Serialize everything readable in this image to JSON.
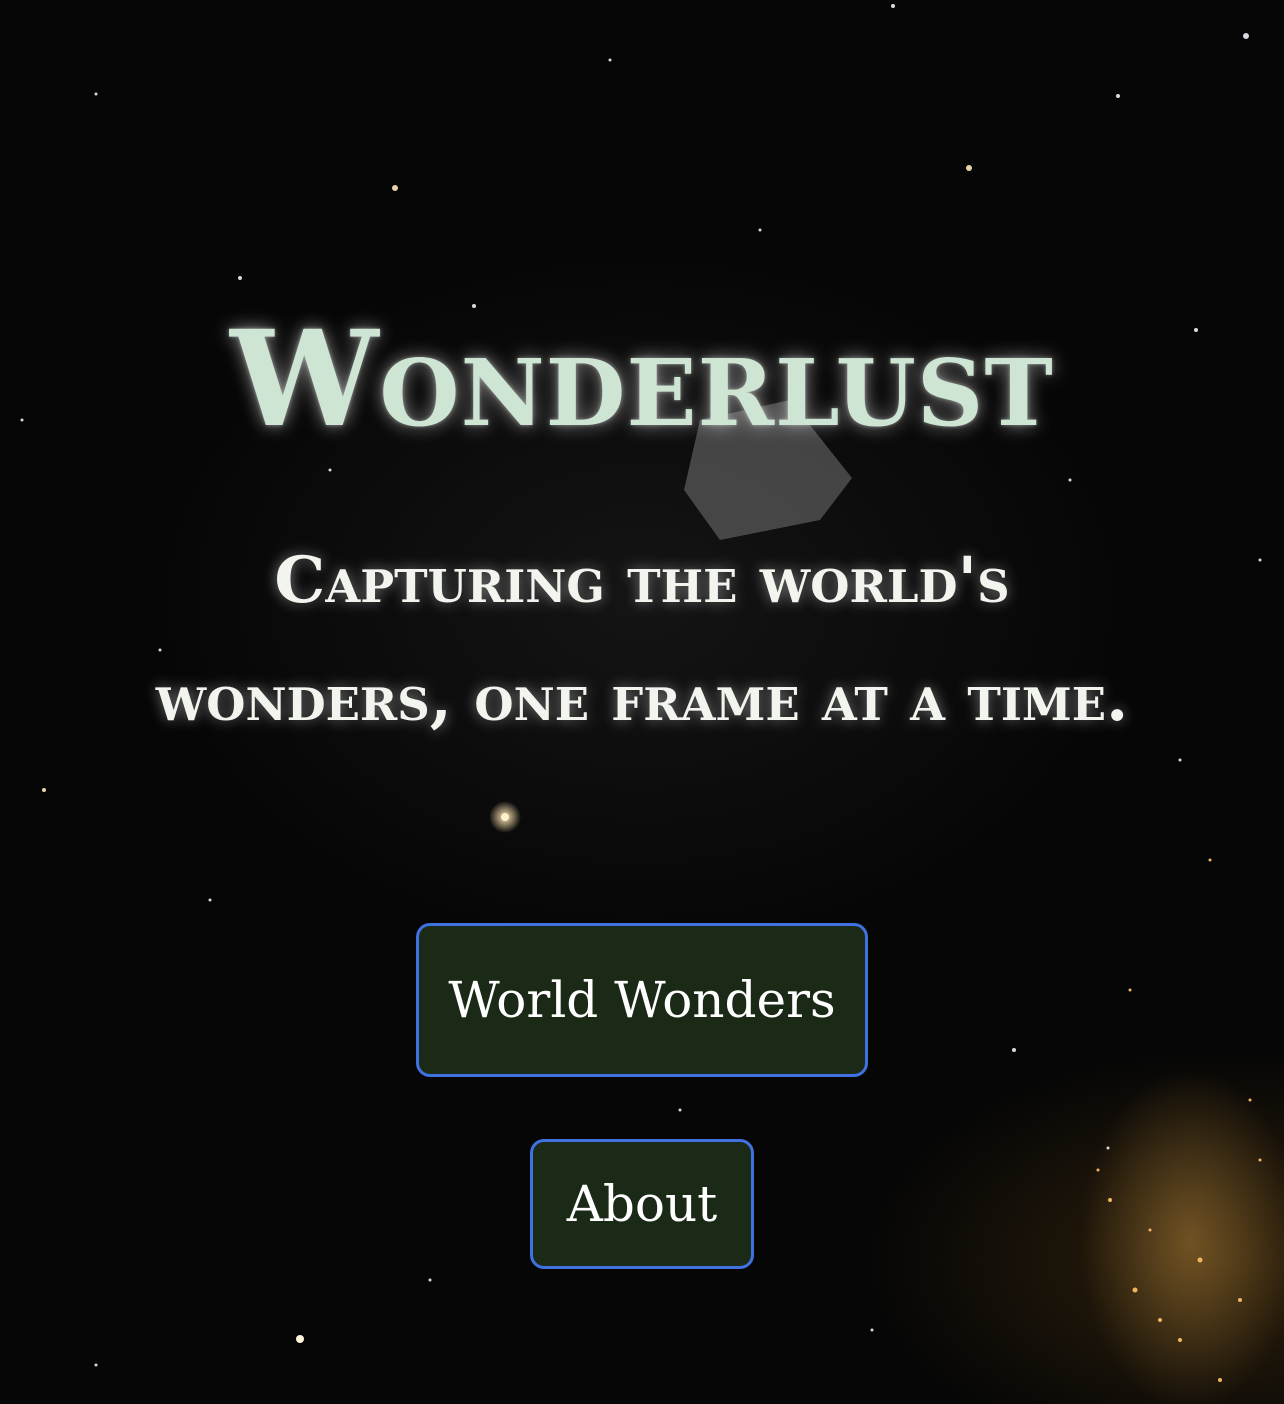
{
  "hero": {
    "title": "Wonderlust",
    "tagline": "Capturing the world's wonders, one frame at a time."
  },
  "nav": {
    "world_wonders_label": "World Wonders",
    "about_label": "About"
  },
  "colors": {
    "title": "#cde5d2",
    "tagline": "#f1f5ee",
    "button_bg": "#1b2a16",
    "button_border": "#3f72e0",
    "background": "#060606"
  }
}
